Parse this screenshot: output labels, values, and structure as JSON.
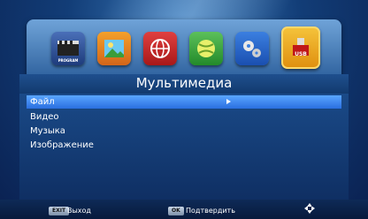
{
  "header": {
    "title": "Мультимедиа"
  },
  "icons": [
    {
      "name": "program-icon",
      "label": "PROGRAM"
    },
    {
      "name": "picture-icon",
      "label": ""
    },
    {
      "name": "globe-network-icon",
      "label": ""
    },
    {
      "name": "ball-icon",
      "label": ""
    },
    {
      "name": "settings-gears-icon",
      "label": ""
    },
    {
      "name": "usb-icon",
      "label": "USB",
      "active": true
    }
  ],
  "menu": {
    "items": [
      {
        "label": "Файл",
        "selected": true
      },
      {
        "label": "Видео",
        "selected": false
      },
      {
        "label": "Музыка",
        "selected": false
      },
      {
        "label": "Изображение",
        "selected": false
      }
    ]
  },
  "footer": {
    "exit_key": "EXIT",
    "exit_label": "Выход",
    "ok_key": "OK",
    "ok_label": "Подтвердить",
    "nav_icon": "navigation-arrows-icon"
  },
  "colors": {
    "selection": "#3a86f0",
    "background": "#123d77",
    "active_border": "#ffd86a"
  }
}
